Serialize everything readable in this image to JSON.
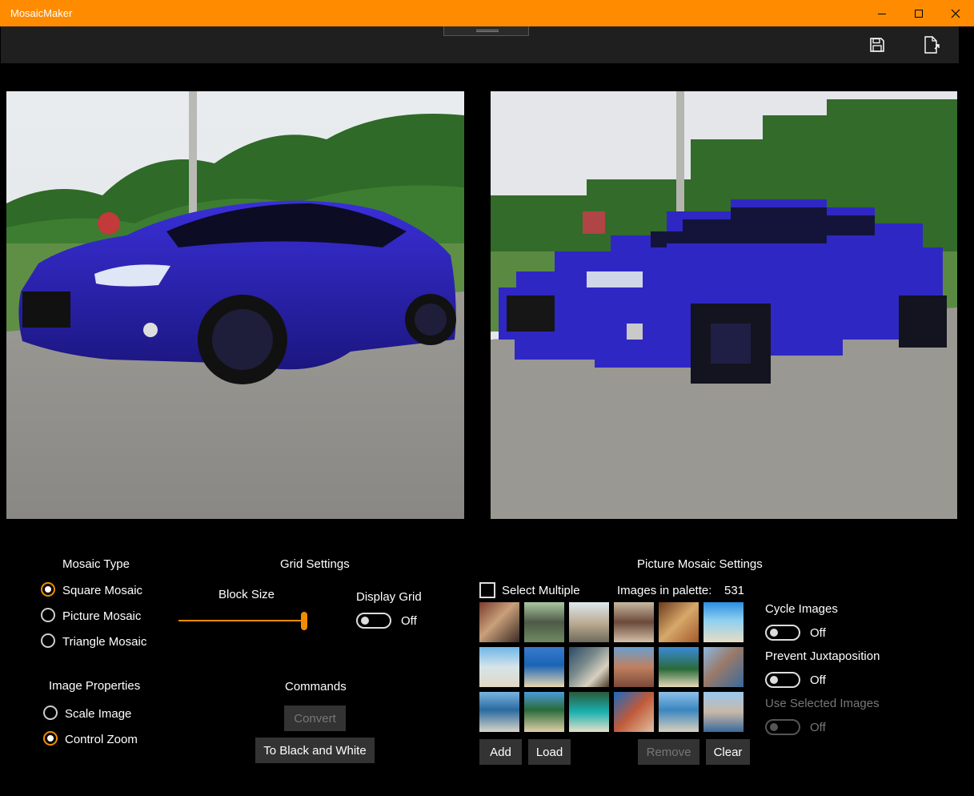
{
  "app": {
    "title": "MosaicMaker"
  },
  "window_controls": {
    "minimize": "minimize-icon",
    "maximize": "maximize-icon",
    "close": "close-icon"
  },
  "toolbar": {
    "save_icon": "save-icon",
    "export_icon": "export-file-icon"
  },
  "mosaic_type": {
    "heading": "Mosaic Type",
    "options": [
      {
        "label": "Square Mosaic",
        "selected": true
      },
      {
        "label": "Picture Mosaic",
        "selected": false
      },
      {
        "label": "Triangle Mosaic",
        "selected": false
      }
    ]
  },
  "image_properties": {
    "heading": "Image Properties",
    "options": [
      {
        "label": "Scale Image",
        "selected": false
      },
      {
        "label": "Control Zoom",
        "selected": true
      }
    ]
  },
  "grid_settings": {
    "heading": "Grid Settings",
    "block_size_label": "Block Size",
    "block_size_level": 1.0,
    "display_grid_label": "Display Grid",
    "display_grid_state": "Off"
  },
  "commands": {
    "heading": "Commands",
    "convert_label": "Convert",
    "bw_label": "To Black and White"
  },
  "picture_mosaic": {
    "heading": "Picture Mosaic Settings",
    "select_multiple_label": "Select Multiple",
    "palette_label": "Images in palette:",
    "palette_count": "531",
    "cycle_label": "Cycle Images",
    "cycle_state": "Off",
    "prevent_label": "Prevent Juxtaposition",
    "prevent_state": "Off",
    "use_selected_label": "Use Selected Images",
    "use_selected_state": "Off",
    "add_label": "Add",
    "load_label": "Load",
    "remove_label": "Remove",
    "clear_label": "Clear"
  },
  "colors": {
    "accent": "#ff8c00",
    "background": "#000000",
    "button": "#333333"
  }
}
